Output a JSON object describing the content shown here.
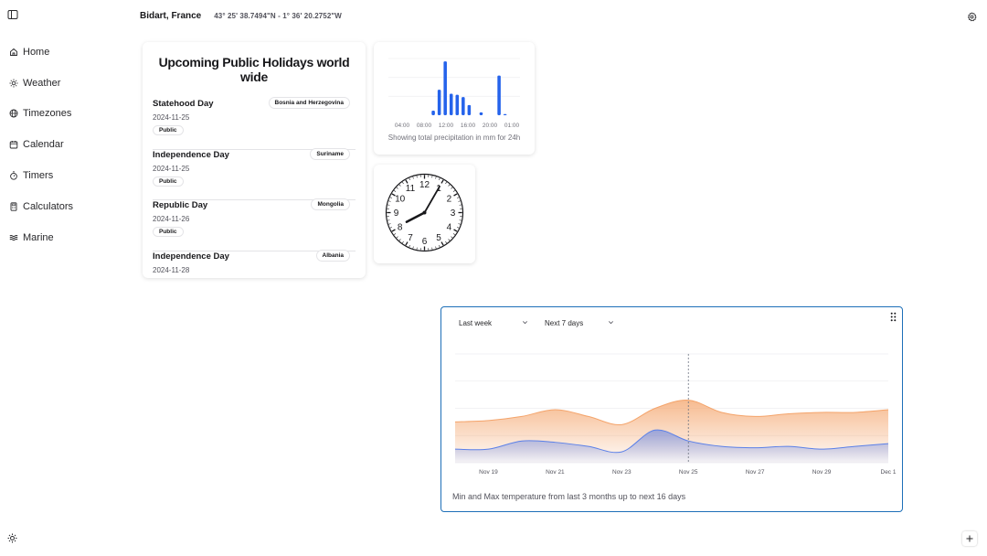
{
  "nav": {
    "items": [
      {
        "label": "Home",
        "icon": "home-icon"
      },
      {
        "label": "Weather",
        "icon": "sun-icon"
      },
      {
        "label": "Timezones",
        "icon": "globe-icon"
      },
      {
        "label": "Calendar",
        "icon": "calendar-icon"
      },
      {
        "label": "Timers",
        "icon": "timer-icon"
      },
      {
        "label": "Calculators",
        "icon": "calculator-icon"
      },
      {
        "label": "Marine",
        "icon": "waves-icon"
      }
    ]
  },
  "header": {
    "location": "Bidart, France",
    "coordinates": "43° 25' 38.7494\"N - 1° 36' 20.2752\"W"
  },
  "holidays": {
    "title": "Upcoming Public Holidays world wide",
    "items": [
      {
        "name": "Statehood Day",
        "date": "2024-11-25",
        "type": "Public",
        "country": "Bosnia and Herzegovina"
      },
      {
        "name": "Independence Day",
        "date": "2024-11-25",
        "type": "Public",
        "country": "Suriname"
      },
      {
        "name": "Republic Day",
        "date": "2024-11-26",
        "type": "Public",
        "country": "Mongolia"
      },
      {
        "name": "Independence Day",
        "date": "2024-11-28",
        "type": "",
        "country": "Albania"
      }
    ]
  },
  "precipitation": {
    "caption": "Showing total precipitation in mm for 24h",
    "bar_color": "#2563eb"
  },
  "clock": {
    "numbers": [
      "12",
      "1",
      "2",
      "3",
      "4",
      "5",
      "6",
      "7",
      "8",
      "9",
      "10",
      "11"
    ],
    "hour": 8,
    "minute": 5
  },
  "temperature": {
    "range_select": "Last week",
    "forecast_select": "Next 7 days",
    "caption": "Min and Max temperature from last 3 months up to next 16 days",
    "max_color": "#f4a46b",
    "min_color": "#5b80e8"
  },
  "chart_data": [
    {
      "type": "bar",
      "categories": [
        "04:00",
        "05:00",
        "06:00",
        "07:00",
        "08:00",
        "09:00",
        "10:00",
        "11:00",
        "12:00",
        "13:00",
        "14:00",
        "15:00",
        "16:00",
        "17:00",
        "18:00",
        "19:00",
        "20:00",
        "21:00",
        "22:00",
        "23:00",
        "00:00",
        "01:00"
      ],
      "tick_labels": [
        "04:00",
        "08:00",
        "12:00",
        "16:00",
        "20:00",
        "01:00"
      ],
      "values": [
        0,
        0,
        0,
        0,
        0,
        0,
        0,
        0.08,
        0.45,
        0.95,
        0.38,
        0.36,
        0.32,
        0.18,
        0,
        0.05,
        0,
        0,
        0.7,
        0.02,
        0,
        0
      ],
      "ylim": [
        0,
        1
      ]
    },
    {
      "type": "area",
      "x_ticks": [
        "Nov 19",
        "Nov 21",
        "Nov 23",
        "Nov 25",
        "Nov 27",
        "Nov 29",
        "Dec 1"
      ],
      "x": [
        "Nov 18",
        "Nov 19",
        "Nov 20",
        "Nov 21",
        "Nov 22",
        "Nov 23",
        "Nov 24",
        "Nov 25",
        "Nov 26",
        "Nov 27",
        "Nov 28",
        "Nov 29",
        "Nov 30",
        "Dec 1"
      ],
      "series": [
        {
          "values": [
            15,
            15.5,
            17,
            19.5,
            17,
            14,
            20,
            23,
            18.5,
            17,
            18,
            18.5,
            18.5,
            19.5
          ]
        },
        {
          "values": [
            5,
            5,
            8,
            7.5,
            6,
            4,
            12,
            8,
            6,
            5.5,
            6,
            5,
            6,
            7
          ]
        }
      ],
      "today": "Nov 25",
      "ylim": [
        0,
        40
      ],
      "grid": true
    }
  ]
}
